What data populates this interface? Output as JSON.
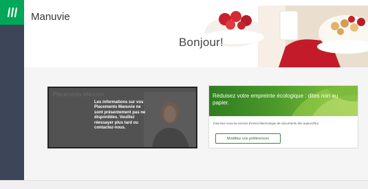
{
  "header": {
    "brand": "Manuvie",
    "greeting": "Bonjour!"
  },
  "cards": {
    "info": {
      "background_title": "Placements Manuvie",
      "message": "Les informations sur vos Placements Manuvie ne sont présentement pas ne disponibles. Veuillez réessayer plus tard ou contactez-nous."
    },
    "green": {
      "title": "Réduisez votre empreinte écologique : dites non au papier.",
      "description": "Inscrivez-vous au service d'envoi électronique de documents dès aujourd'hui.",
      "button_label": "Modifiez vos préférences"
    }
  },
  "colors": {
    "sidebar": "#3d4658",
    "brand_green": "#00a758"
  }
}
